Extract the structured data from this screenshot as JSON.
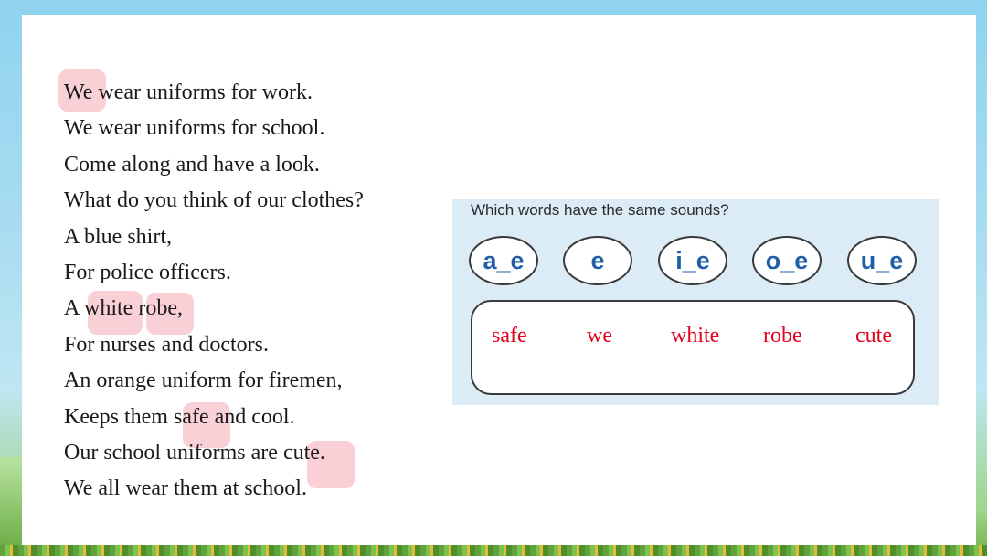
{
  "poem": {
    "lines": [
      "We wear uniforms for work.",
      "We wear uniforms for school.",
      "Come along and have a look.",
      "What do you think of our clothes?",
      "A blue shirt,",
      "For police officers.",
      "A white robe,",
      "For nurses and doctors.",
      "An orange uniform for firemen,",
      "Keeps them safe and cool.",
      "Our school uniforms are cute.",
      "We all wear them at school."
    ]
  },
  "exercise": {
    "title": "Which words have the same sounds?",
    "patterns": [
      "a_e",
      "e",
      "i_e",
      "o_e",
      "u_e"
    ],
    "answers": [
      "safe",
      "we",
      "white",
      "robe",
      "cute"
    ]
  },
  "colors": {
    "highlight": "#f4aab4",
    "pattern_text": "#1f5fa8",
    "answer_text": "#e3001b"
  }
}
